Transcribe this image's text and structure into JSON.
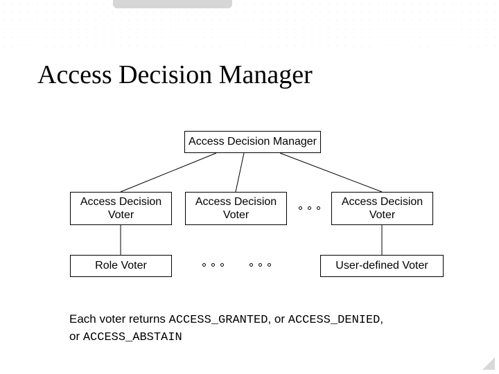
{
  "title": "Access Decision Manager",
  "boxes": {
    "manager": "Access Decision Manager",
    "voter1": "Access Decision\nVoter",
    "voter2": "Access Decision\nVoter",
    "voter3": "Access Decision\nVoter",
    "role_voter": "Role Voter",
    "user_voter": "User-defined Voter"
  },
  "caption": {
    "lead": "Each voter returns ",
    "c1": "ACCESS_GRANTED",
    "mid1": ", or ",
    "c2": "ACCESS_DENIED",
    "mid2": ",\nor ",
    "c3": "ACCESS_ABSTAIN"
  }
}
